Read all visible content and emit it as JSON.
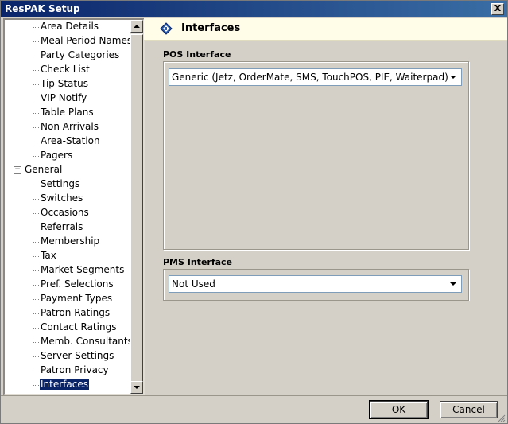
{
  "window": {
    "title": "ResPAK Setup",
    "close_label": "X"
  },
  "tree": {
    "items_a": [
      "Area Details",
      "Meal Period Names",
      "Party Categories",
      "Check List",
      "Tip Status",
      "VIP Notify",
      "Table Plans",
      "Non Arrivals",
      "Area-Station",
      "Pagers"
    ],
    "group": {
      "label": "General",
      "expander": "−"
    },
    "items_b": [
      "Settings",
      "Switches",
      "Occasions",
      "Referrals",
      "Membership",
      "Tax",
      "Market Segments",
      "Pref. Selections",
      "Payment Types",
      "Patron Ratings",
      "Contact Ratings",
      "Memb. Consultants",
      "Server Settings",
      "Patron Privacy",
      "Interfaces"
    ]
  },
  "banner": {
    "title": "Interfaces",
    "icon": "diamond-info-icon"
  },
  "pos": {
    "label": "POS Interface",
    "value": "Generic (Jetz, OrderMate, SMS, TouchPOS, PIE, Waiterpad)"
  },
  "pms": {
    "label": "PMS Interface",
    "value": "Not Used"
  },
  "buttons": {
    "ok": "OK",
    "cancel": "Cancel"
  },
  "colors": {
    "title_bar": "#0a246a",
    "selection": "#0a246a",
    "banner_bg": "#fffde8",
    "dialog_bg": "#d4d0c8"
  }
}
